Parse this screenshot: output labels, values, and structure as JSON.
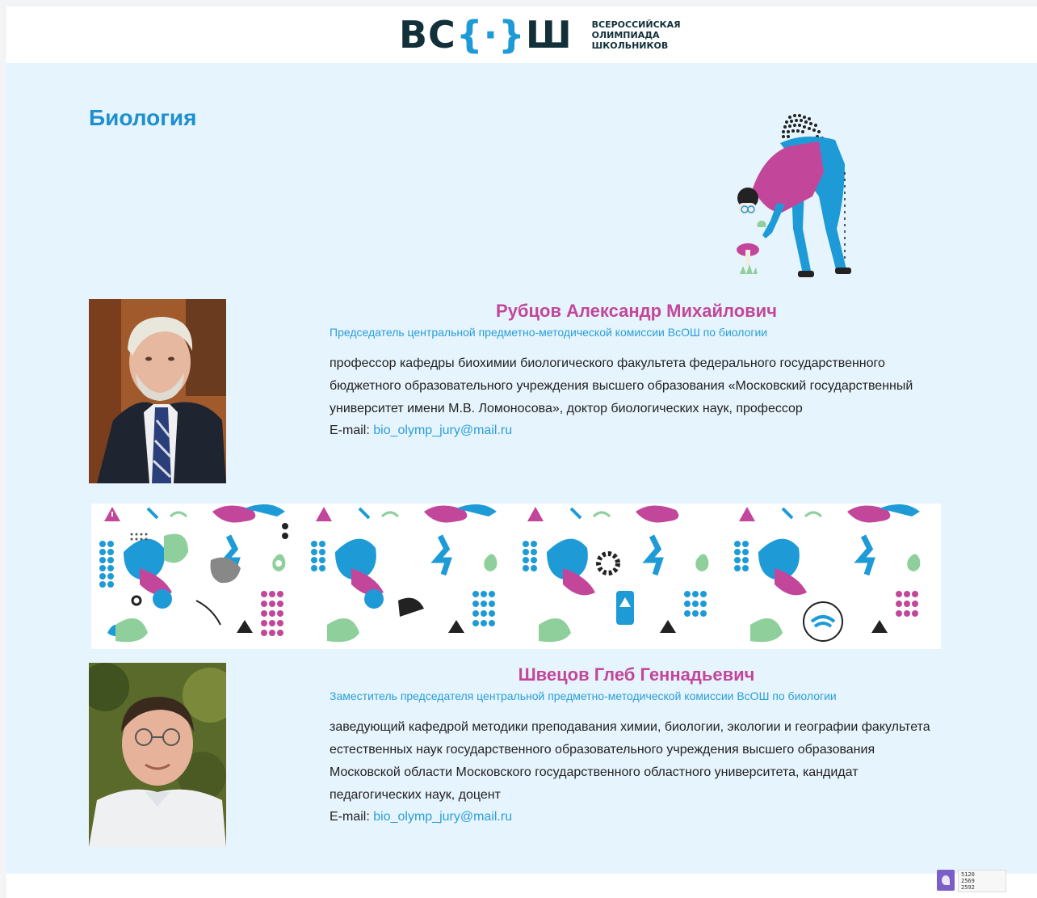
{
  "header": {
    "logo_text_left": "ВС",
    "logo_text_brace": "{·}",
    "logo_text_right": "Ш",
    "logo_sub_1": "Всероссийская",
    "logo_sub_2": "олимпиада",
    "logo_sub_3": "школьников"
  },
  "page": {
    "title": "Биология"
  },
  "people": [
    {
      "name": "Рубцов Александр Михайлович",
      "role": "Председатель центральной предметно-методической комиссии ВсОШ по биологии",
      "description": "профессор кафедры биохимии биологического факультета федерального государственного бюджетного образовательного учреждения высшего образования «Московский государственный университет имени М.В. Ломоносова», доктор биологических наук, профессор",
      "email_label": "E-mail:",
      "email": "bio_olymp_jury@mail.ru"
    },
    {
      "name": "Швецов Глеб Геннадьевич",
      "role": "Заместитель председателя центральной предметно-методической комиссии ВсОШ по биологии",
      "description": "заведующий кафедрой методики преподавания химии, биологии, экологии и географии факультета естественных наук государственного образовательного учреждения высшего образования Московской области Московского государственного областного университета, кандидат педагогических наук, доцент",
      "email_label": "E-mail:",
      "email": "bio_olymp_jury@mail.ru"
    }
  ],
  "footer": {
    "counter_line_1": "5120",
    "counter_line_2": "2569",
    "counter_line_3": "2592"
  },
  "colors": {
    "accent_blue": "#1e8fd0",
    "accent_pink": "#c2479a",
    "background": "#e6f4fd",
    "green": "#8ecf9c"
  }
}
